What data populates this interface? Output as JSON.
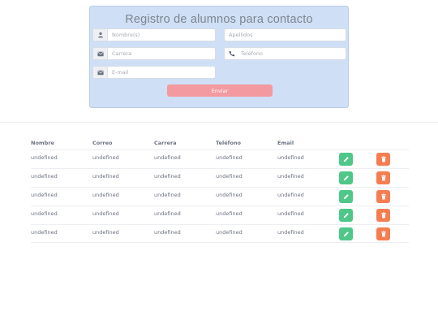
{
  "form": {
    "title": "Registro de alumnos para contacto",
    "fields": {
      "nombre": {
        "placeholder": "Nombre(s)",
        "icon": "user-icon"
      },
      "apellidos": {
        "placeholder": "Apellidos"
      },
      "carrera": {
        "placeholder": "Carrera",
        "icon": "envelope-icon"
      },
      "telefono": {
        "placeholder": "Teléfono",
        "icon": "phone-icon"
      },
      "email": {
        "placeholder": "E-mail",
        "icon": "envelope-icon"
      }
    },
    "submit_label": "Enviar",
    "colors": {
      "card": "#cfdff5",
      "submit": "#f39aa0"
    }
  },
  "table": {
    "headers": [
      "Nombre",
      "Correo",
      "Carrera",
      "Teléfono",
      "Email"
    ],
    "rows": [
      [
        "undefined",
        "undefined",
        "undefined",
        "undefined",
        "undefined"
      ],
      [
        "undefined",
        "undefined",
        "undefined",
        "undefined",
        "undefined"
      ],
      [
        "undefined",
        "undefined",
        "undefined",
        "undefined",
        "undefined"
      ],
      [
        "undefined",
        "undefined",
        "undefined",
        "undefined",
        "undefined"
      ],
      [
        "undefined",
        "undefined",
        "undefined",
        "undefined",
        "undefined"
      ]
    ],
    "actions": {
      "edit_icon": "pencil-icon",
      "delete_icon": "trash-icon",
      "edit_color": "#4fc788",
      "delete_color": "#f57d52"
    }
  }
}
